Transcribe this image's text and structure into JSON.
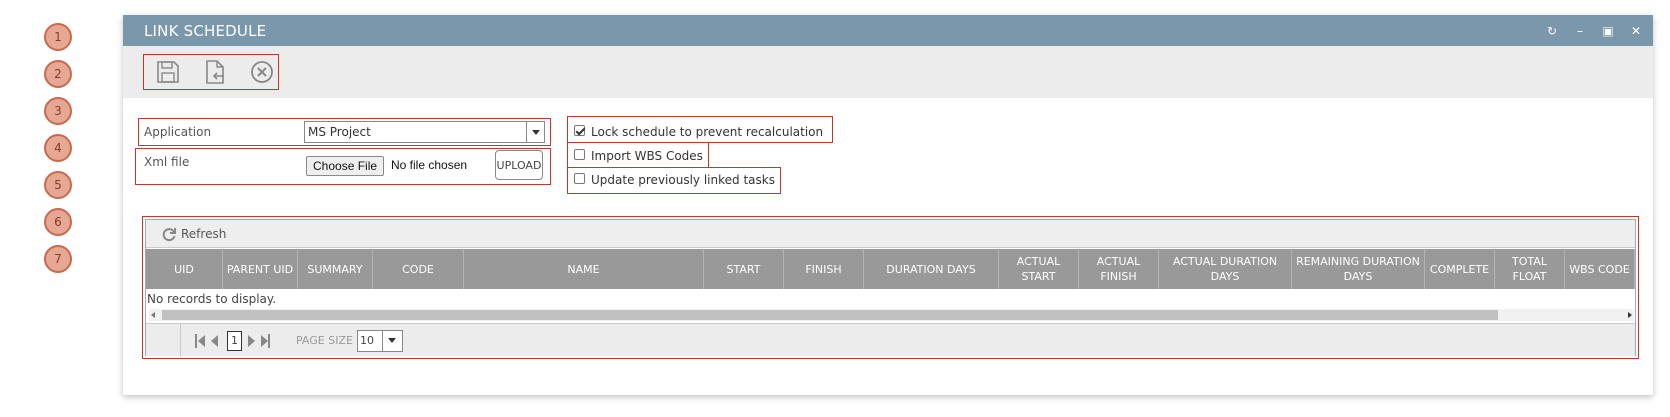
{
  "steps": [
    "1",
    "2",
    "3",
    "4",
    "5",
    "6",
    "7"
  ],
  "window": {
    "title": "LINK SCHEDULE",
    "controls": [
      "refresh-icon",
      "minimize-icon",
      "maximize-icon",
      "close-icon"
    ]
  },
  "toolbar": {
    "buttons": [
      "save-icon",
      "import-icon",
      "cancel-icon"
    ]
  },
  "form": {
    "application_label": "Application",
    "application_value": "MS Project",
    "xml_label": "Xml file",
    "choose_file_label": "Choose File",
    "no_file_text": "No file chosen",
    "upload_label": "UPLOAD",
    "lock_label": "Lock schedule to prevent recalculation",
    "lock_checked": true,
    "import_wbs_label": "Import WBS Codes",
    "import_wbs_checked": false,
    "update_linked_label": "Update previously linked tasks",
    "update_linked_checked": false
  },
  "grid": {
    "refresh_label": "Refresh",
    "columns": [
      "UID",
      "PARENT UID",
      "SUMMARY",
      "CODE",
      "NAME",
      "START",
      "FINISH",
      "DURATION DAYS",
      "ACTUAL START",
      "ACTUAL FINISH",
      "ACTUAL DURATION DAYS",
      "REMAINING DURATION DAYS",
      "COMPLETE",
      "TOTAL FLOAT",
      "WBS CODE"
    ],
    "empty_text": "No records to display.",
    "pager": {
      "current_page": "1",
      "page_size_label": "PAGE SIZE",
      "page_size": "10"
    }
  },
  "colors": {
    "titlebar": "#7b97ab",
    "highlight": "#c0392b",
    "step_fill": "#e6a794",
    "header_bg": "#999999"
  }
}
